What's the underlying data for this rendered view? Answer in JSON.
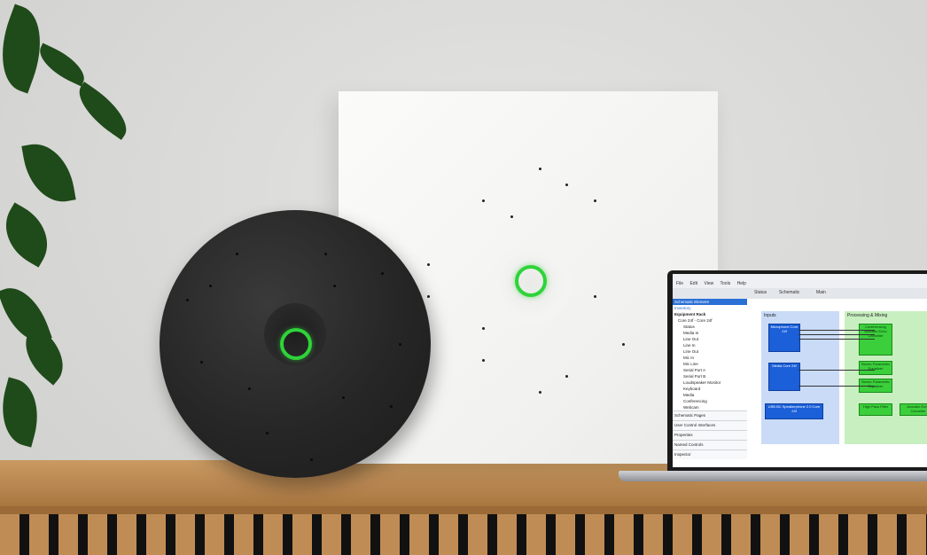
{
  "scene": {
    "description_free": true,
    "accent_green": "#2fd33a",
    "panel_color": "#f4f4f2",
    "disc_color": "#262626",
    "shelf_color": "#b7854f"
  },
  "laptop": {
    "menu": [
      "File",
      "Edit",
      "View",
      "Tools",
      "Help"
    ],
    "tabs": [
      "Status",
      "Schematic",
      "Main"
    ],
    "left_header": "Schematic Element",
    "inventory_label": "Inventory",
    "tree": [
      "Equipment Rack",
      "Core 24f - Core 24f",
      "Status",
      "Media In",
      "Line Out",
      "Line In",
      "Line Out",
      "Mic In",
      "Mic Line",
      "Serial Port A",
      "Serial Port B",
      "Loudspeaker Monitor",
      "Keyboard",
      "Media",
      "Conferencing",
      "Webcam"
    ],
    "sections": [
      "Schematic Pages",
      "User Control Interfaces",
      "Properties",
      "Named Controls",
      "Inspector"
    ],
    "zone_inputs": "Inputs",
    "zone_processing": "Processing & Mixing",
    "blue_blocks": [
      "Microphone Core 24f",
      "Media Core 24f",
      "USB BC Speakerphone 2.0 Core 24f"
    ],
    "green_blocks": [
      "Conferencing Acoustic Echo Canceller",
      "Stereo Parametric Equalizer",
      "Stereo Parametric Equalizer",
      "High Pass Filter",
      "Acoustic Echo Canceller"
    ]
  }
}
